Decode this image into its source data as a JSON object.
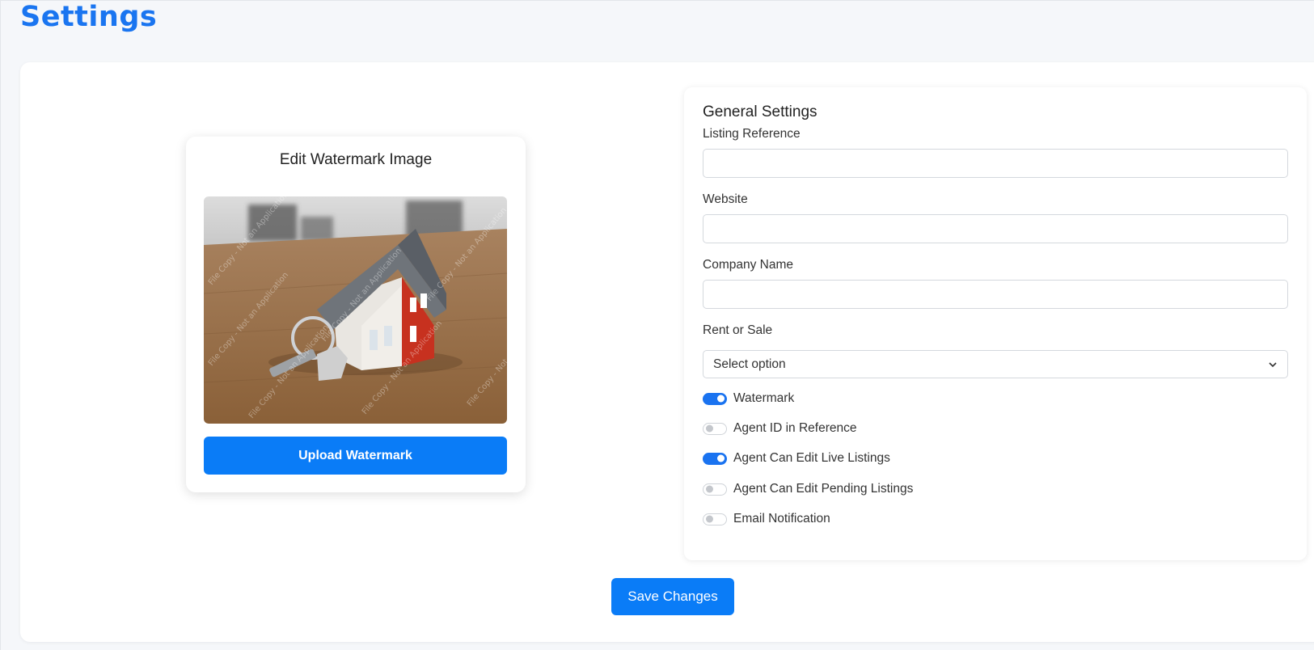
{
  "page": {
    "title": "Settings"
  },
  "watermark_card": {
    "title": "Edit Watermark Image",
    "watermark_text": "File Copy - Not an Application",
    "upload_label": "Upload Watermark"
  },
  "general": {
    "title": "General Settings",
    "fields": [
      {
        "label": "Listing Reference",
        "value": "",
        "placeholder": ""
      },
      {
        "label": "Website",
        "value": "",
        "placeholder": ""
      },
      {
        "label": "Company Name",
        "value": "",
        "placeholder": ""
      }
    ],
    "rent_or_sale": {
      "label": "Rent or Sale",
      "selected": "Select option"
    },
    "toggles": [
      {
        "label": "Watermark",
        "checked": true
      },
      {
        "label": "Agent ID in Reference",
        "checked": false
      },
      {
        "label": "Agent Can Edit Live Listings",
        "checked": true
      },
      {
        "label": "Agent Can Edit Pending Listings",
        "checked": false
      },
      {
        "label": "Email Notification",
        "checked": false
      }
    ]
  },
  "save_label": "Save Changes",
  "colors": {
    "accent": "#0a7cf7",
    "title": "#1a75f0",
    "toggle_on": "#1a73f0"
  }
}
